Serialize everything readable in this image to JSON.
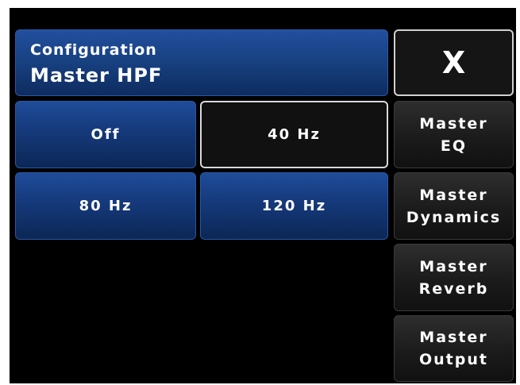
{
  "header": {
    "subtitle": "Configuration",
    "title": "Master HPF"
  },
  "close": {
    "label": "X"
  },
  "options": [
    {
      "label": "Off",
      "selected": false
    },
    {
      "label": "40 Hz",
      "selected": true
    },
    {
      "label": "80 Hz",
      "selected": false
    },
    {
      "label": "120 Hz",
      "selected": false
    }
  ],
  "side_menu": [
    {
      "line1": "Master",
      "line2": "EQ"
    },
    {
      "line1": "Master",
      "line2": "Dynamics"
    },
    {
      "line1": "Master",
      "line2": "Reverb"
    },
    {
      "line1": "Master",
      "line2": "Output"
    }
  ],
  "colors": {
    "accent_blue": "#17407f",
    "background": "#000000",
    "selected_border": "#d9d9d9"
  }
}
